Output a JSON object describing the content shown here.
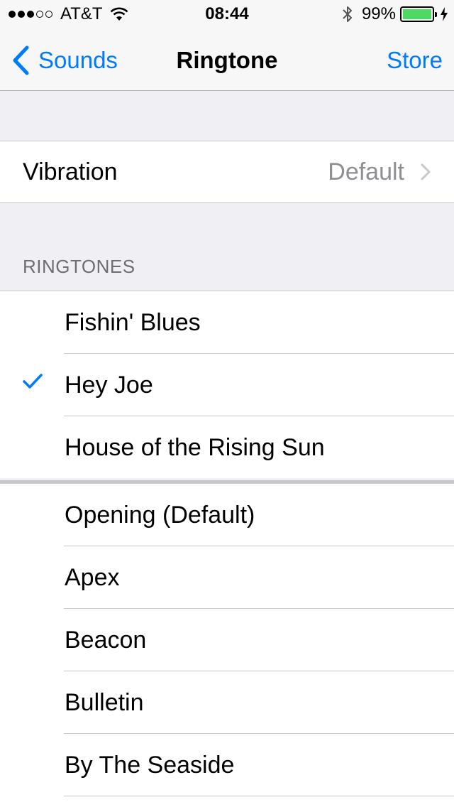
{
  "status_bar": {
    "carrier": "AT&T",
    "time": "08:44",
    "battery": "99%",
    "battery_level": 0.99,
    "signal_bars_filled": 3,
    "signal_bars_total": 5,
    "icons": [
      "signal-dots",
      "wifi-icon",
      "bluetooth-icon",
      "battery-icon",
      "charging-bolt-icon"
    ]
  },
  "nav": {
    "back_label": "Sounds",
    "title": "Ringtone",
    "store_label": "Store"
  },
  "vibration": {
    "label": "Vibration",
    "value": "Default"
  },
  "section_header": "RINGTONES",
  "ringtones_purchased": [
    {
      "label": "Fishin' Blues",
      "selected": false
    },
    {
      "label": "Hey Joe",
      "selected": true
    },
    {
      "label": "House of the Rising Sun",
      "selected": false
    }
  ],
  "ringtones_builtin": [
    {
      "label": "Opening (Default)",
      "selected": false
    },
    {
      "label": "Apex",
      "selected": false
    },
    {
      "label": "Beacon",
      "selected": false
    },
    {
      "label": "Bulletin",
      "selected": false
    },
    {
      "label": "By The Seaside",
      "selected": false
    }
  ],
  "colors": {
    "accent": "#007aff",
    "background": "#efeff4",
    "battery": "#4cd964",
    "secondary_text": "#8e8e93"
  }
}
